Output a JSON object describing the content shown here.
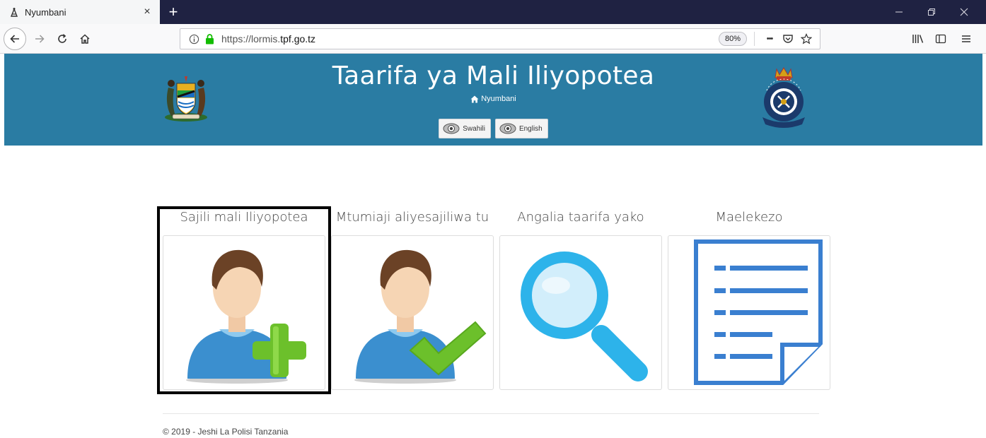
{
  "browser": {
    "tab_title": "Nyumbani",
    "tab_close": "×",
    "new_tab": "+",
    "url_prefix": "https://lormis.",
    "url_domain": "tpf.go.tz",
    "zoom": "80%",
    "more_actions": "•••"
  },
  "header": {
    "title": "Taarifa ya Mali Iliyopotea",
    "breadcrumb": "Nyumbani",
    "languages": [
      "Swahili",
      "English"
    ],
    "colors": {
      "banner": "#2a7ca3"
    }
  },
  "cards": [
    {
      "title": "Sajili mali Iliyopotea",
      "icon": "user-add-icon"
    },
    {
      "title": "Mtumiaji aliyesajiliwa tu",
      "icon": "user-check-icon"
    },
    {
      "title": "Angalia taarifa yako",
      "icon": "magnifier-icon"
    },
    {
      "title": "Maelekezo",
      "icon": "document-list-icon"
    }
  ],
  "footer": {
    "text": "© 2019 - Jeshi La Polisi Tanzania"
  }
}
